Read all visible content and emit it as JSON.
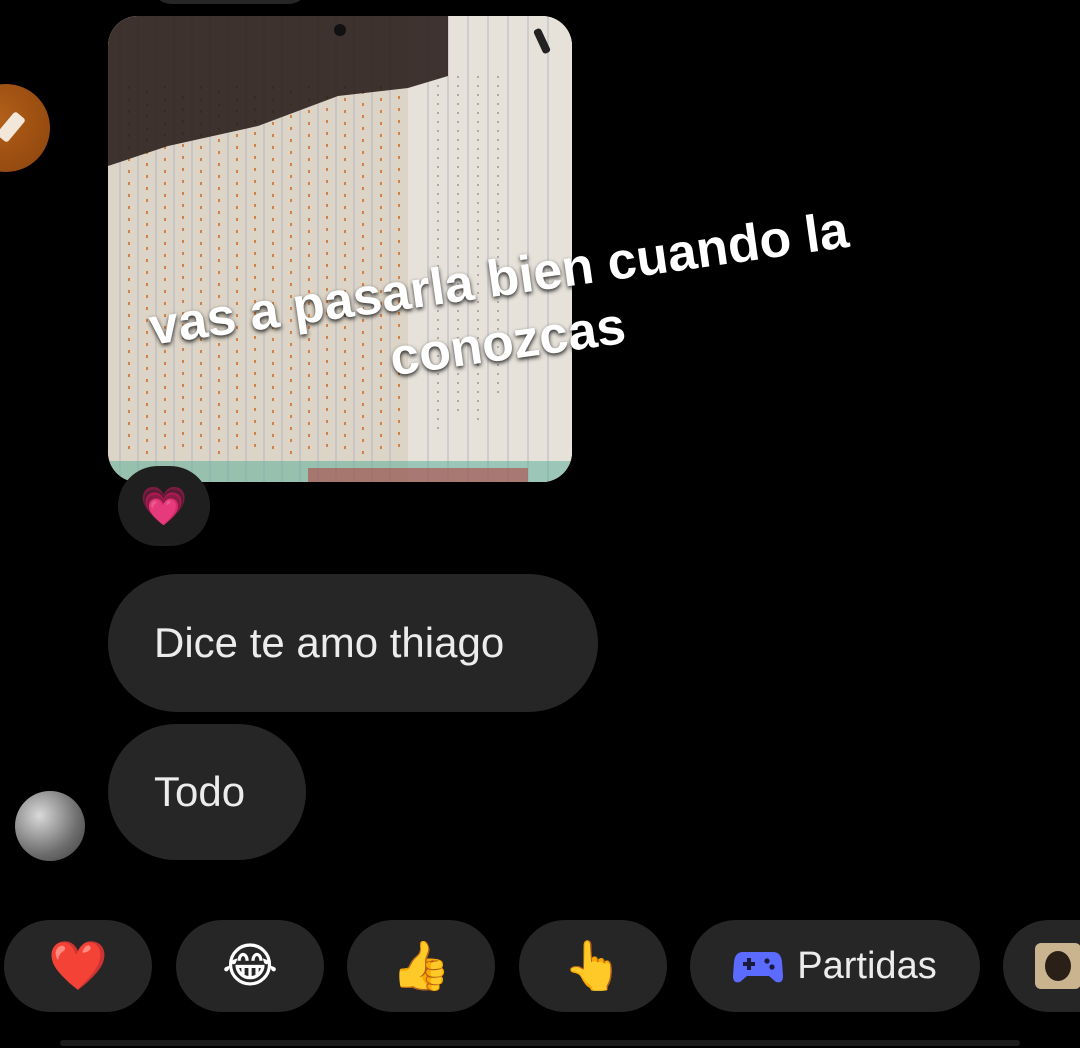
{
  "chat": {
    "reaction_emoji": "💗",
    "messages": [
      {
        "text": "Dice te amo thiago"
      },
      {
        "text": "Todo"
      }
    ]
  },
  "overlay_caption": {
    "line1": "vas a pasarla bien cuando la",
    "line2": "conozcas"
  },
  "quick_replies": [
    {
      "emoji": "❤️",
      "icon": "heart-icon"
    },
    {
      "emoji": "😂",
      "icon": "laughing-icon"
    },
    {
      "emoji": "👍",
      "icon": "thumbs-up-icon"
    },
    {
      "emoji": "👆",
      "icon": "pointing-up-icon"
    },
    {
      "label": "Partidas",
      "icon": "game-controller-icon"
    }
  ],
  "colors": {
    "background": "#000000",
    "bubble": "#262626",
    "game_icon": "#5b6bff"
  }
}
